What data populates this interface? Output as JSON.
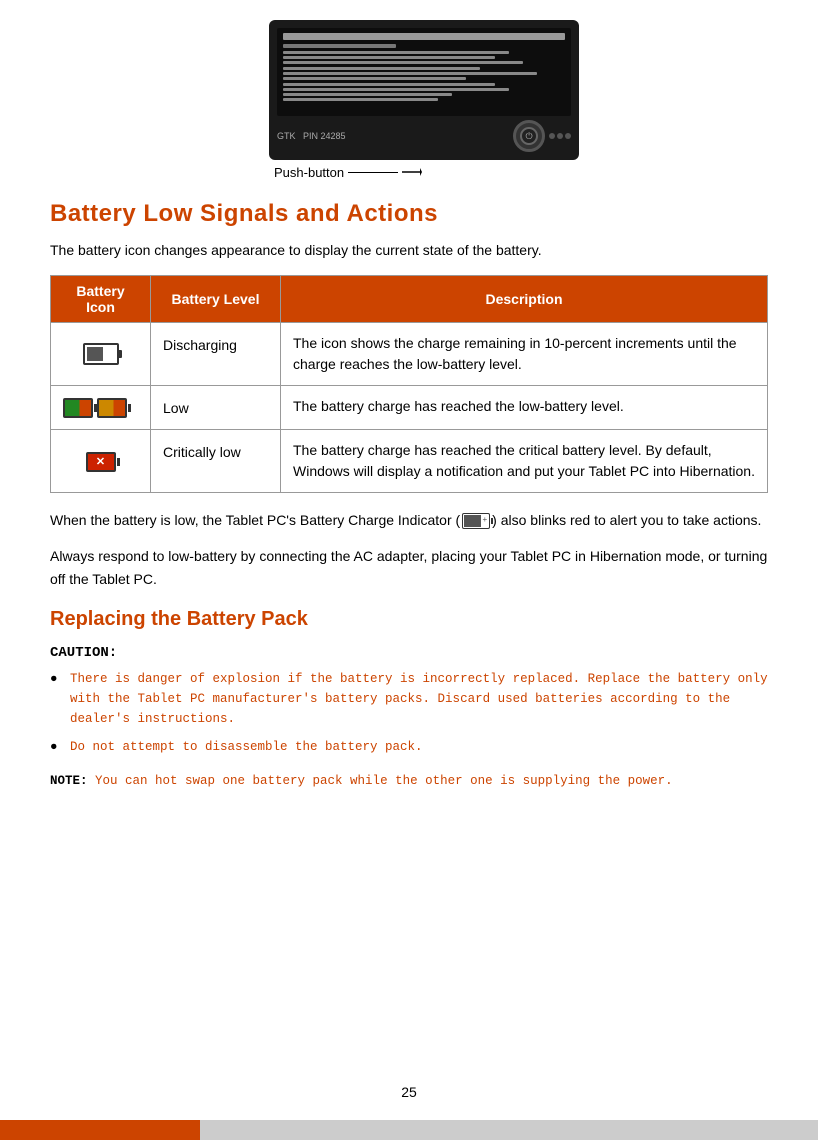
{
  "page": {
    "number": "25"
  },
  "top_image": {
    "push_button_label": "Push-button"
  },
  "battery_low_section": {
    "heading": "Battery Low Signals and Actions",
    "intro": "The battery icon changes appearance to display the current state of the battery.",
    "table": {
      "headers": [
        "Battery Icon",
        "Battery Level",
        "Description"
      ],
      "rows": [
        {
          "icon_type": "discharging",
          "level": "Discharging",
          "description": "The icon shows the charge remaining in 10-percent increments until the charge reaches the low-battery level."
        },
        {
          "icon_type": "low",
          "level": "Low",
          "description": "The battery charge has reached the low-battery level."
        },
        {
          "icon_type": "critical",
          "level": "Critically low",
          "description": "The battery charge has reached the critical battery level. By default, Windows will display a notification and put your Tablet PC into Hibernation."
        }
      ]
    },
    "para1": "When the battery is low, the Tablet PC's Battery Charge Indicator (",
    "para1_end": ") also blinks red to alert you to take actions.",
    "para2": "Always respond to low-battery by connecting the AC adapter, placing your Tablet PC in Hibernation mode, or turning off the Tablet PC."
  },
  "replacing_section": {
    "heading": "Replacing the Battery Pack",
    "caution_label": "CAUTION:",
    "caution_items": [
      "There is danger of explosion if the battery is incorrectly replaced. Replace the battery only with the Tablet PC manufacturer's battery packs. Discard used batteries according to the dealer's instructions.",
      "Do not attempt to disassemble the battery pack."
    ],
    "note_label": "NOTE:",
    "note_text": " You can hot swap one battery pack while the other one is supplying the power."
  }
}
